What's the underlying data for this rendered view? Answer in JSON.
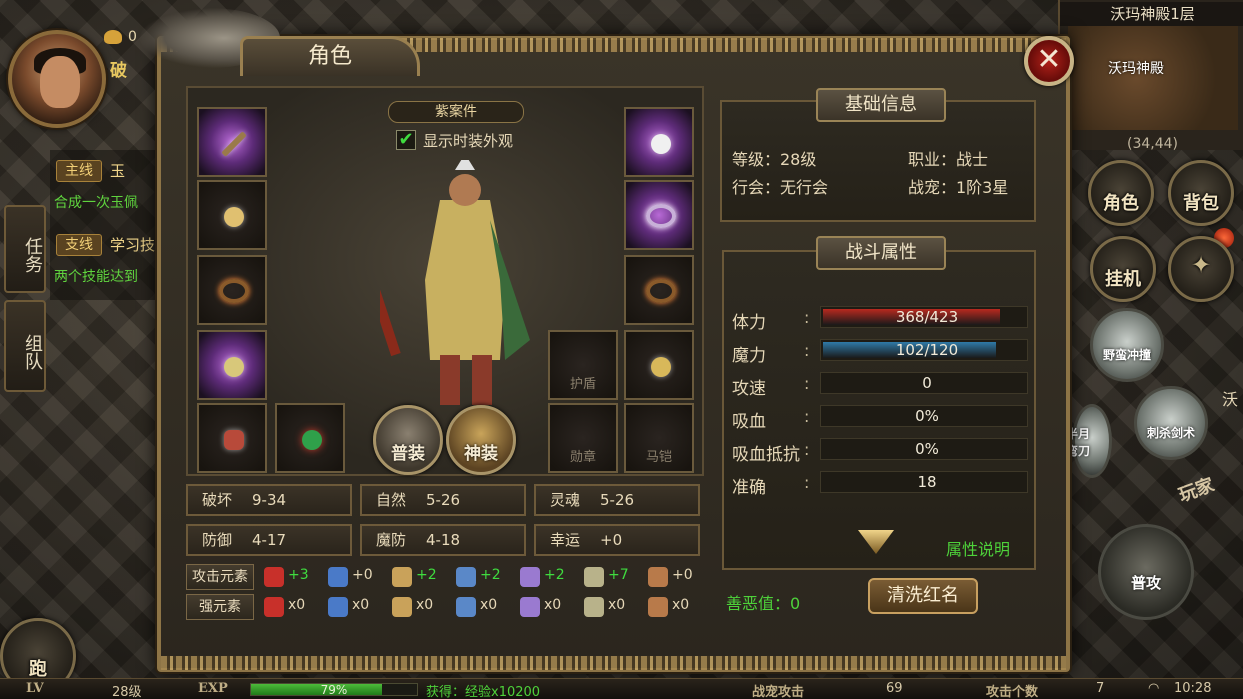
{
  "hud": {
    "gold_count": "0",
    "player_name_partial": "破",
    "tabs": {
      "quest": "任务",
      "team": "组队"
    },
    "quests": [
      {
        "tag": "主线",
        "title": "玉",
        "desc": "合成一次玉佩"
      },
      {
        "tag": "支线",
        "title": "学习技",
        "desc": "两个技能达到"
      }
    ],
    "map": {
      "name": "沃玛神殿1层",
      "label": "沃玛神殿",
      "coords": "(34,44)"
    },
    "buttons": {
      "role": "角色",
      "bag": "背包",
      "auto": "挂机",
      "run": "跑"
    },
    "skills": {
      "charge": "野蛮冲撞",
      "sword": "刺杀剑术",
      "half_moon": "半月弯刀",
      "attack": "普攻",
      "side": "沃"
    },
    "player_tag": "玩家"
  },
  "bottom_bar": {
    "lv_label": "LV",
    "lv_value": "28级",
    "exp_label": "EXP",
    "exp_pct": "79%",
    "exp_fraction": 0.79,
    "gain": "获得：经验x10200",
    "pet_attack_label": "战宠攻击",
    "pet_attack_value": "69",
    "attack_count_label": "攻击个数",
    "attack_count_value": "7",
    "time": "10:28"
  },
  "dialog": {
    "title": "角色",
    "close": "✕",
    "outfit_name": "紫案件",
    "show_fashion_check": "✔",
    "show_fashion_label": "显示时装外观",
    "slots_left": [
      "purple",
      "dim",
      "dim",
      "purple",
      "dim"
    ],
    "slots_right": [
      "purple",
      "purple",
      "dim",
      "dim",
      "dim"
    ],
    "slot_labels": {
      "shield": "护盾",
      "medal": "勋章",
      "armor": "马铠"
    },
    "normal_equip": "普装",
    "god_equip": "神装",
    "stats": [
      {
        "k": "破坏",
        "v": "9-34"
      },
      {
        "k": "自然",
        "v": "5-26"
      },
      {
        "k": "灵魂",
        "v": "5-26"
      },
      {
        "k": "防御",
        "v": "4-17"
      },
      {
        "k": "魔防",
        "v": "4-18"
      },
      {
        "k": "幸运",
        "v": "+0"
      }
    ],
    "attack_elements_label": "攻击元素",
    "strong_elements_label": "强元素",
    "attack_elements": [
      "+3",
      "+0",
      "+2",
      "+2",
      "+2",
      "+7",
      "+0"
    ],
    "strong_elements": [
      "x0",
      "x0",
      "x0",
      "x0",
      "x0",
      "x0",
      "x0"
    ],
    "element_colors": [
      "#c8302a",
      "#4a7ac8",
      "#c9a25a",
      "#5a88c8",
      "#9a7ad0",
      "#b8b28a",
      "#b87a4a"
    ],
    "element_value_colors": [
      "#3fdc3f",
      "#e6d8b8",
      "#3fdc3f",
      "#3fdc3f",
      "#3fdc3f",
      "#3fdc3f",
      "#e6d8b8"
    ],
    "basic_info": {
      "header": "基础信息",
      "level": "等级：28级",
      "job": "职业：战士",
      "guild": "行会：无行会",
      "pet": "战宠：1阶3星"
    },
    "battle": {
      "header": "战斗属性",
      "rows": [
        {
          "label": "体力",
          "value": "368/423",
          "fill": 0.87,
          "color": "#b8291f"
        },
        {
          "label": "魔力",
          "value": "102/120",
          "fill": 0.85,
          "color": "#2f7aa8"
        },
        {
          "label": "攻速",
          "value": "0"
        },
        {
          "label": "吸血",
          "value": "0%"
        },
        {
          "label": "吸血抵抗",
          "value": "0%"
        },
        {
          "label": "准确",
          "value": "18"
        }
      ],
      "help": "属性说明"
    },
    "karma": "善恶值：0",
    "clear_red": "清洗红名"
  }
}
